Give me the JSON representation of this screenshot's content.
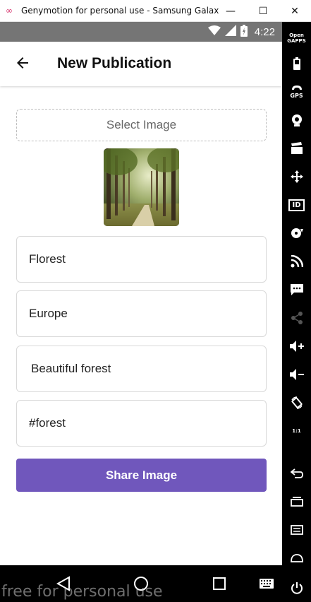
{
  "window": {
    "title": "Genymotion for personal use - Samsung Galaxy S...",
    "logo_glyph": "∞",
    "minimize_glyph": "—",
    "maximize_glyph": "☐",
    "close_glyph": "✕"
  },
  "status_bar": {
    "time": "4:22",
    "icons": [
      "wifi-icon",
      "signal-icon",
      "battery-icon"
    ]
  },
  "app_bar": {
    "title": "New Publication",
    "back_icon": "arrow-left-icon"
  },
  "form": {
    "select_image_label": "Select Image",
    "title_value": "Florest",
    "location_value": "Europe",
    "description_value": "Beautiful forest",
    "tags_value": "#forest",
    "share_label": "Share Image"
  },
  "side_toolbar": {
    "open_gapps_label": "Open\nGAPPS",
    "gps_label": "GPS",
    "id_label": "ID",
    "ratio_label": "1:1"
  },
  "watermark": "free for personal use",
  "colors": {
    "accent": "#7057bc",
    "status_bar": "#757575",
    "toolbar": "#000000"
  }
}
